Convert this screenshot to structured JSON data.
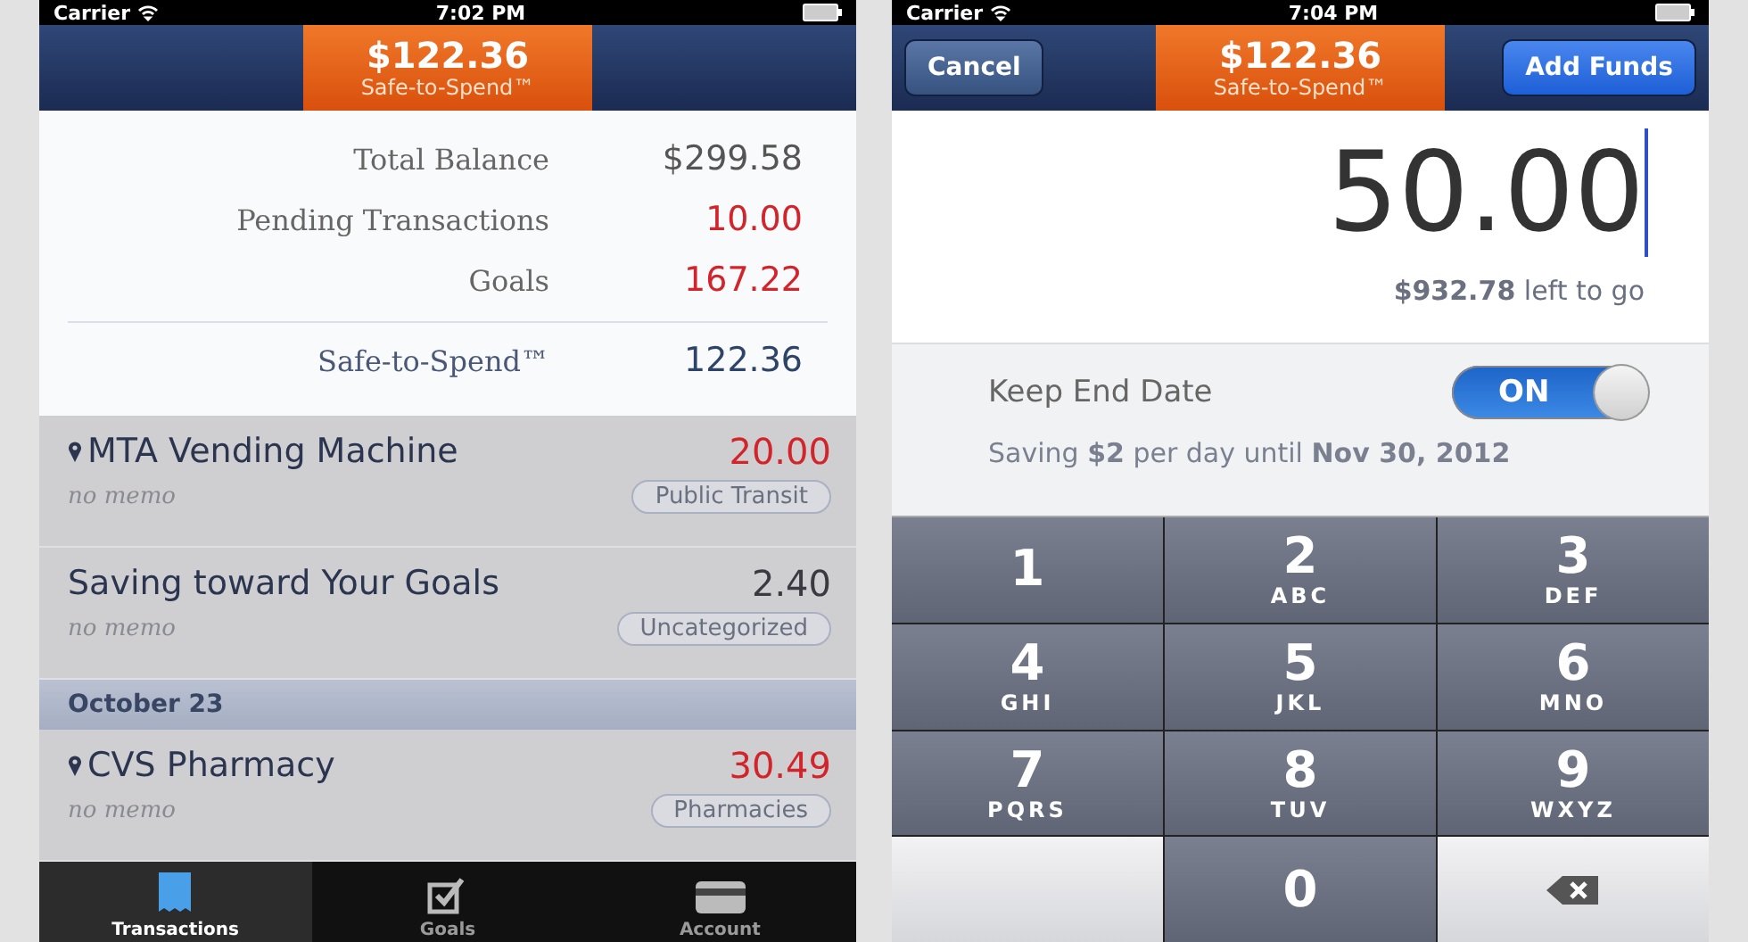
{
  "left_screen": {
    "status_bar": {
      "carrier": "Carrier",
      "time": "7:02 PM"
    },
    "header": {
      "amount": "$122.36",
      "label": "Safe-to-Spend™"
    },
    "summary": [
      {
        "label": "Total Balance",
        "value": "$299.58",
        "negative": false
      },
      {
        "label": "Pending Transactions",
        "value": "10.00",
        "negative": true
      },
      {
        "label": "Goals",
        "value": "167.22",
        "negative": true
      }
    ],
    "total": {
      "label": "Safe-to-Spend™",
      "value": "122.36"
    },
    "transactions": [
      {
        "kind": "transaction",
        "name": "MTA Vending Machine",
        "has_location": true,
        "amount": "20.00",
        "negative": true,
        "memo": "no memo",
        "category": "Public Transit"
      },
      {
        "kind": "transaction",
        "name": "Saving toward Your Goals",
        "has_location": false,
        "amount": "2.40",
        "negative": false,
        "memo": "no memo",
        "category": "Uncategorized"
      },
      {
        "kind": "date_header",
        "label": "October 23"
      },
      {
        "kind": "transaction",
        "name": "CVS Pharmacy",
        "has_location": true,
        "amount": "30.49",
        "negative": true,
        "memo": "no memo",
        "category": "Pharmacies"
      }
    ],
    "tab_bar": [
      {
        "kind": "receipt",
        "label": "Transactions",
        "selected": true
      },
      {
        "kind": "check",
        "label": "Goals",
        "selected": false
      },
      {
        "kind": "card",
        "label": "Account",
        "selected": false
      }
    ]
  },
  "right_screen": {
    "status_bar": {
      "carrier": "Carrier",
      "time": "7:04 PM"
    },
    "cancel_button": "Cancel",
    "header": {
      "amount": "$122.36",
      "label": "Safe-to-Spend™"
    },
    "add_funds_button": "Add Funds",
    "amount": "50.00",
    "left_to_go": "**$932.78** left to go",
    "keep_end_date": {
      "label": "Keep End Date",
      "on": true,
      "toggle_text": "ON"
    },
    "saving_note": "Saving **$2** per day until **Nov 30, 2012**",
    "keypad": [
      {
        "kind": "digit",
        "digit": "1"
      },
      {
        "kind": "digit",
        "digit": "2",
        "letters": "ABC"
      },
      {
        "kind": "digit",
        "digit": "3",
        "letters": "DEF"
      },
      {
        "kind": "digit",
        "digit": "4",
        "letters": "GHI"
      },
      {
        "kind": "digit",
        "digit": "5",
        "letters": "JKL"
      },
      {
        "kind": "digit",
        "digit": "6",
        "letters": "MNO"
      },
      {
        "kind": "digit",
        "digit": "7",
        "letters": "PQRS"
      },
      {
        "kind": "digit",
        "digit": "8",
        "letters": "TUV"
      },
      {
        "kind": "digit",
        "digit": "9",
        "letters": "WXYZ"
      },
      {
        "kind": "blank"
      },
      {
        "kind": "digit",
        "digit": "0"
      },
      {
        "kind": "delete"
      }
    ]
  }
}
